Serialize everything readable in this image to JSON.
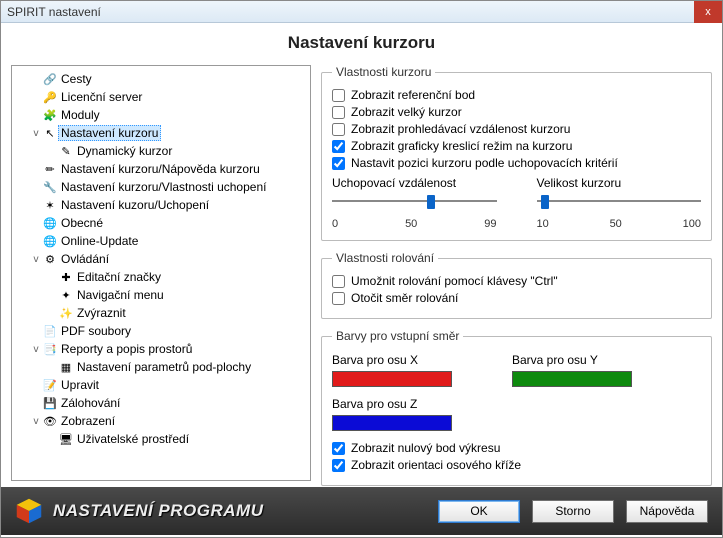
{
  "window": {
    "title": "SPIRIT nastavení",
    "close": "x"
  },
  "heading": "Nastavení kurzoru",
  "tree": [
    {
      "lvl": 1,
      "exp": "",
      "icon": "link",
      "label": "Cesty"
    },
    {
      "lvl": 1,
      "exp": "",
      "icon": "key",
      "label": "Licenční server"
    },
    {
      "lvl": 1,
      "exp": "",
      "icon": "mod",
      "label": "Moduly"
    },
    {
      "lvl": 1,
      "exp": "v",
      "icon": "cursor",
      "label": "Nastavení kurzoru",
      "sel": true
    },
    {
      "lvl": 2,
      "exp": "",
      "icon": "wand",
      "label": "Dynamický kurzor"
    },
    {
      "lvl": 1,
      "exp": "",
      "icon": "pencil",
      "label": "Nastavení kurzoru/Nápověda kurzoru"
    },
    {
      "lvl": 1,
      "exp": "",
      "icon": "wrench",
      "label": "Nastavení kurzoru/Vlastnosti uchopení"
    },
    {
      "lvl": 1,
      "exp": "",
      "icon": "snap",
      "label": "Nastavení kuzoru/Uchopení"
    },
    {
      "lvl": 1,
      "exp": "",
      "icon": "globe",
      "label": "Obecné"
    },
    {
      "lvl": 1,
      "exp": "",
      "icon": "globe",
      "label": "Online-Update"
    },
    {
      "lvl": 1,
      "exp": "v",
      "icon": "gear",
      "label": "Ovládání"
    },
    {
      "lvl": 2,
      "exp": "",
      "icon": "plus",
      "label": "Editační značky"
    },
    {
      "lvl": 2,
      "exp": "",
      "icon": "star",
      "label": "Navigační menu"
    },
    {
      "lvl": 2,
      "exp": "",
      "icon": "hi",
      "label": "Zvýraznit"
    },
    {
      "lvl": 1,
      "exp": "",
      "icon": "pdf",
      "label": "PDF soubory"
    },
    {
      "lvl": 1,
      "exp": "v",
      "icon": "report",
      "label": "Reporty a popis prostorů"
    },
    {
      "lvl": 2,
      "exp": "",
      "icon": "layer",
      "label": "Nastavení parametrů pod-plochy"
    },
    {
      "lvl": 1,
      "exp": "",
      "icon": "edit",
      "label": "Upravit"
    },
    {
      "lvl": 1,
      "exp": "",
      "icon": "disk",
      "label": "Zálohování"
    },
    {
      "lvl": 1,
      "exp": "v",
      "icon": "eye",
      "label": "Zobrazení"
    },
    {
      "lvl": 2,
      "exp": "",
      "icon": "ui",
      "label": "Uživatelské prostředí"
    }
  ],
  "group1": {
    "legend": "Vlastnosti kurzoru",
    "c1": {
      "label": "Zobrazit referenční bod",
      "checked": false
    },
    "c2": {
      "label": "Zobrazit velký kurzor",
      "checked": false
    },
    "c3": {
      "label": "Zobrazit prohledávací vzdálenost kurzoru",
      "checked": false
    },
    "c4": {
      "label": "Zobrazit graficky kreslicí režim na kurzoru",
      "checked": true
    },
    "c5": {
      "label": "Nastavit pozici kurzoru podle uchopovacích kritérií",
      "checked": true
    },
    "slider1": {
      "title": "Uchopovací vzdálenost",
      "min": "0",
      "mid": "50",
      "max": "99",
      "pos": 58
    },
    "slider2": {
      "title": "Velikost kurzoru",
      "min": "10",
      "mid": "50",
      "max": "100",
      "pos": 3
    }
  },
  "group2": {
    "legend": "Vlastnosti rolování",
    "c1": {
      "label": "Umožnit rolování pomocí klávesy \"Ctrl\"",
      "checked": false
    },
    "c2": {
      "label": "Otočit směr rolování",
      "checked": false
    }
  },
  "group3": {
    "legend": "Barvy pro vstupní směr",
    "colX": {
      "label": "Barva pro osu X",
      "color": "#e11b1b"
    },
    "colY": {
      "label": "Barva pro osu Y",
      "color": "#0e8a0e"
    },
    "colZ": {
      "label": "Barva pro osu Z",
      "color": "#0b0bd6"
    },
    "c1": {
      "label": "Zobrazit nulový bod výkresu",
      "checked": true
    },
    "c2": {
      "label": "Zobrazit orientaci osového kříže",
      "checked": true
    }
  },
  "footer": {
    "title": "NASTAVENÍ  PROGRAMU",
    "ok": "OK",
    "cancel": "Storno",
    "help": "Nápověda"
  }
}
